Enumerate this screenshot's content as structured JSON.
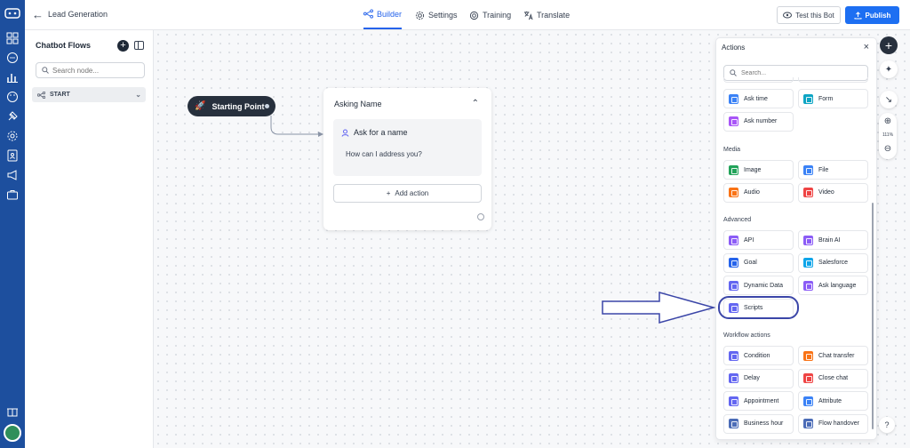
{
  "app": {
    "title": "Lead Generation",
    "back_icon": "arrow-left-icon",
    "sidebar_icons": [
      "grid-icon",
      "chat-icon",
      "bar-chart-icon",
      "palette-icon",
      "plug-icon",
      "gear-icon",
      "contacts-icon",
      "megaphone-icon",
      "briefcase-icon",
      "gift-icon"
    ]
  },
  "tabs": [
    {
      "label": "Builder",
      "icon": "flow-icon",
      "active": true
    },
    {
      "label": "Settings",
      "icon": "gear-icon",
      "active": false
    },
    {
      "label": "Training",
      "icon": "target-icon",
      "active": false
    },
    {
      "label": "Translate",
      "icon": "translate-icon",
      "active": false
    }
  ],
  "header_buttons": {
    "test": "Test this Bot",
    "publish": "Publish"
  },
  "flows_panel": {
    "title": "Chatbot Flows",
    "search_placeholder": "Search node...",
    "flow_item": "START"
  },
  "canvas": {
    "start_node": "Starting Point",
    "node": {
      "title": "Asking Name",
      "question_title": "Ask for a name",
      "question_text": "How can I address you?",
      "add_action": "Add action"
    }
  },
  "actions_panel": {
    "title": "Actions",
    "search_placeholder": "Search...",
    "top_items": [
      {
        "label": "Ask time",
        "color": "#3b82f6"
      },
      {
        "label": "Form",
        "color": "#0ea5c4"
      },
      {
        "label": "Ask number",
        "color": "#a855f7"
      }
    ],
    "sections": [
      {
        "title": "Media",
        "items": [
          {
            "label": "Image",
            "color": "#22a35a"
          },
          {
            "label": "File",
            "color": "#3b82f6"
          },
          {
            "label": "Audio",
            "color": "#f97316"
          },
          {
            "label": "Video",
            "color": "#ef4444"
          }
        ]
      },
      {
        "title": "Advanced",
        "items": [
          {
            "label": "API",
            "color": "#8b5cf6"
          },
          {
            "label": "Brain AI",
            "color": "#8b5cf6"
          },
          {
            "label": "Goal",
            "color": "#2563eb"
          },
          {
            "label": "Salesforce",
            "color": "#0ea5e9"
          },
          {
            "label": "Dynamic Data",
            "color": "#6366f1"
          },
          {
            "label": "Ask language",
            "color": "#8b5cf6"
          },
          {
            "label": "Scripts",
            "color": "#6366f1"
          }
        ]
      },
      {
        "title": "Workflow actions",
        "items": [
          {
            "label": "Condition",
            "color": "#6366f1"
          },
          {
            "label": "Chat transfer",
            "color": "#f97316"
          },
          {
            "label": "Delay",
            "color": "#6366f1"
          },
          {
            "label": "Close chat",
            "color": "#ef4444"
          },
          {
            "label": "Appointment",
            "color": "#6366f1"
          },
          {
            "label": "Attribute",
            "color": "#3b82f6"
          },
          {
            "label": "Business hour",
            "color": "#4b6cb7"
          },
          {
            "label": "Flow handover",
            "color": "#4b6cb7"
          }
        ]
      }
    ]
  },
  "zoom": {
    "level": "111%"
  },
  "colors": {
    "sidebar": "#1d4f9e",
    "accent": "#2563eb",
    "publish": "#1d6ff2",
    "highlight": "#3b46a8"
  }
}
